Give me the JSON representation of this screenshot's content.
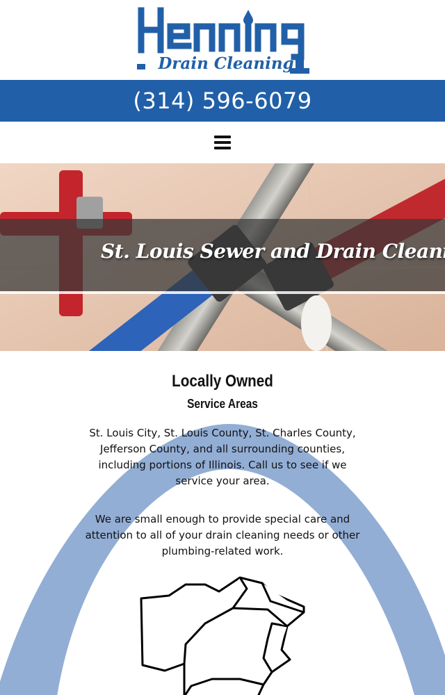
{
  "header": {
    "logo_line1": "Henning",
    "logo_line2": "Drain Cleaning"
  },
  "phone": {
    "number": "(314) 596-6079"
  },
  "nav": {
    "menu_icon": "hamburger-menu-icon"
  },
  "hero": {
    "title": "St. Louis Sewer and Drain Cleaning"
  },
  "section": {
    "title": "Locally Owned",
    "subtitle": "Service Areas",
    "paragraph1": "St. Louis City, St. Louis County, St. Charles County, Jefferson County, and all surrounding counties, including portions of Illinois. Call us to see if we service your area.",
    "paragraph2": "We are small enough to provide special care and attention to all of your drain cleaning needs or other plumbing-related work."
  },
  "colors": {
    "brand_blue": "#2160a8",
    "arch_blue": "#93aed5"
  }
}
